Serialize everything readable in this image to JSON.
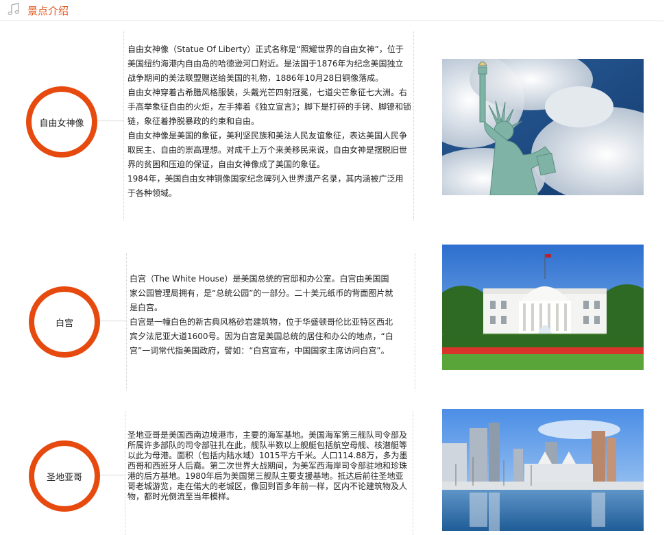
{
  "header": {
    "title": "景点介绍",
    "icon": "music-note-icon",
    "accent": "#e0541a"
  },
  "attractions": [
    {
      "name": "自由女神像",
      "paragraphs": [
        "自由女神像（Statue Of Liberty）正式名称是“照耀世界的自由女神”，位于美国纽约海港内自由岛的哈德逊河口附近。是法国于1876年为纪念美国独立战争期间的美法联盟赠送给美国的礼物，1886年10月28日铜像落成。",
        "自由女神穿着古希腊风格服装，头戴光芒四射冠冕，七道尖芒象征七大洲。右手高举象征自由的火炬，左手捧着《独立宣言》；脚下是打碎的手铐、脚镣和锁链，象征着挣脱暴政的约束和自由。",
        "自由女神像是美国的象征，美利坚民族和美法人民友谊象征，表达美国人民争取民主、自由的崇高理想。对成千上万个来美移民来说，自由女神是摆脱旧世界的贫困和压迫的保证，自由女神像成了美国的象征。",
        "1984年，美国自由女神铜像国家纪念碑列入世界遗产名录，其内涵被广泛用于各种领域。"
      ],
      "photo": "statue-of-liberty-photo"
    },
    {
      "name": "白宫",
      "paragraphs": [
        "白宫（The White House）是美国总统的官邸和办公室。白宫由美国国家公园管理局拥有，是“总统公园”的一部分。二十美元纸币的背面图片就是白宫。",
        "白宫是一幢白色的新古典风格砂岩建筑物，位于华盛顿哥伦比亚特区西北宾夕法尼亚大道1600号。因为白宫是美国总统的居住和办公的地点，“白宫”一词常代指美国政府，譬如：“白宫宣布，中国国家主席访问白宫”。"
      ],
      "photo": "white-house-photo"
    },
    {
      "name": "圣地亚哥",
      "paragraphs": [
        "圣地亚哥是美国西南边境港市，主要的海军基地。美国海军第三舰队司令部及所属许多部队的司令部驻扎在此，舰队半数以上舰艇包括航空母舰、核潜艇等以此为母港。面积（包括内陆水域）1015平方千米。人口114.88万，多为墨西哥和西班牙人后裔。第二次世界大战期间，为美军西海岸司令部驻地和珍珠港的后方基地。1980年后为美国第三舰队主要支援基地。抵达后前往圣地亚哥老城游览，走在偌大的老城区，像回到百多年前一样，区内不论建筑物及人物，都时光倒流至当年模样。"
      ],
      "photo": "san-diego-photo"
    }
  ]
}
